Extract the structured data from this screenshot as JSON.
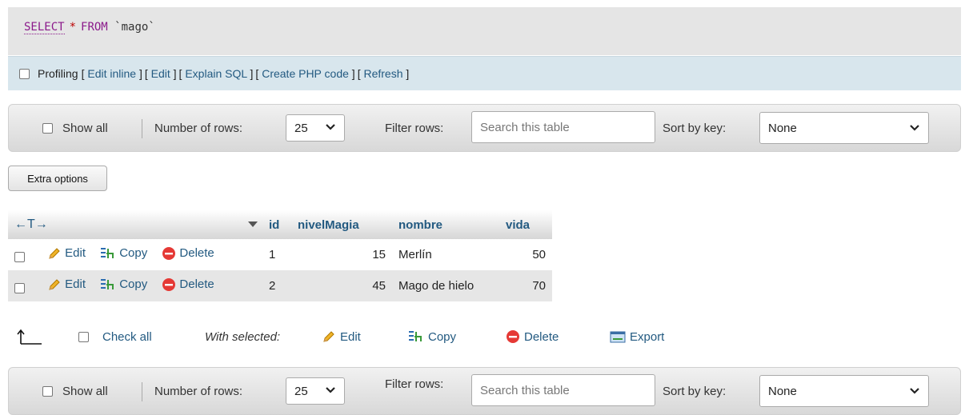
{
  "sql": {
    "keyword": "SELECT",
    "operator": "*",
    "from": "FROM",
    "table": "`mago`"
  },
  "profiling": {
    "label": "Profiling",
    "links": [
      "Edit inline",
      "Edit",
      "Explain SQL",
      "Create PHP code",
      "Refresh"
    ]
  },
  "nav": {
    "show_all": "Show all",
    "number_of_rows_label": "Number of rows:",
    "number_of_rows_value": "25",
    "filter_rows_label": "Filter rows:",
    "filter_placeholder": "Search this table",
    "sort_by_key_label": "Sort by key:",
    "sort_by_key_value": "None"
  },
  "extra_options": "Extra options",
  "table": {
    "col_arrows": "←T→",
    "columns": [
      "id",
      "nivelMagia",
      "nombre",
      "vida"
    ],
    "row_actions": {
      "edit": "Edit",
      "copy": "Copy",
      "delete": "Delete"
    },
    "rows": [
      {
        "id": "1",
        "nivelMagia": "15",
        "nombre": "Merlín",
        "vida": "50"
      },
      {
        "id": "2",
        "nivelMagia": "45",
        "nombre": "Mago de hielo",
        "vida": "70"
      }
    ]
  },
  "bulk": {
    "check_all": "Check all",
    "with_selected": "With selected:",
    "edit": "Edit",
    "copy": "Copy",
    "delete": "Delete",
    "export": "Export"
  },
  "colors": {
    "link": "#235a81",
    "keyword": "#8b1a8b",
    "delete_red": "#e53935"
  }
}
